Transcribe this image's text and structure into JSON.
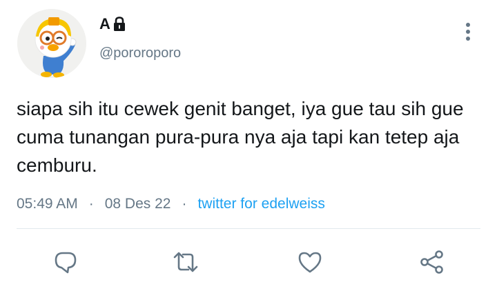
{
  "tweet": {
    "display_name": "A",
    "handle": "@pororoporo",
    "text": "siapa sih itu cewek genit banget, iya gue tau sih gue cuma tunangan pura-pura nya aja tapi kan tetep aja cemburu.",
    "time": "05:49 AM",
    "separator": "·",
    "date": "08 Des 22",
    "source": "twitter for edelweiss"
  },
  "icons": {
    "lock": "lock-icon",
    "more": "more-vertical-icon",
    "reply": "reply-icon",
    "retweet": "retweet-icon",
    "like": "heart-icon",
    "share": "share-icon"
  },
  "colors": {
    "text": "#14171a",
    "secondary": "#657786",
    "link": "#1da1f2",
    "divider": "#e1e8ed"
  }
}
